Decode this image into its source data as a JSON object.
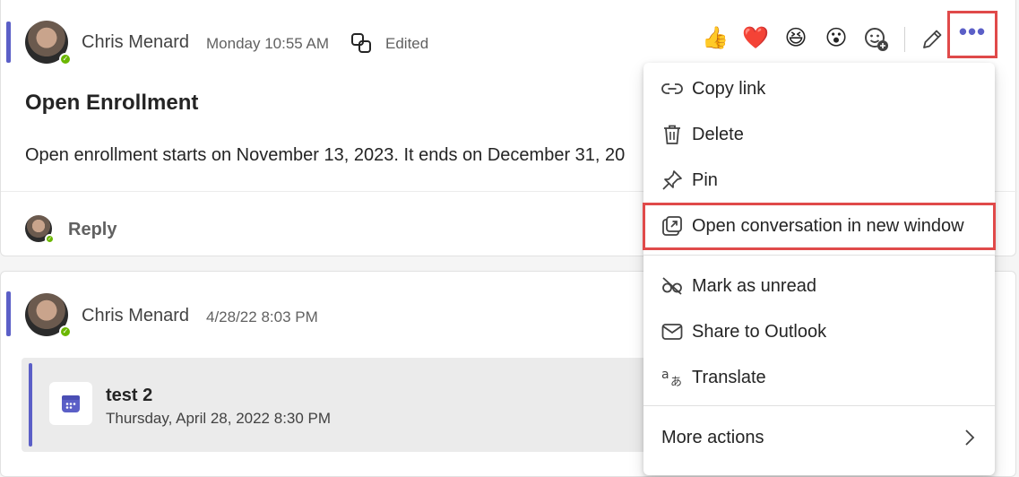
{
  "message1": {
    "author": "Chris Menard",
    "timestamp": "Monday 10:55 AM",
    "edited_label": "Edited",
    "title": "Open Enrollment",
    "body": "Open enrollment starts on November 13, 2023. It ends on December 31, 20",
    "reply_label": "Reply",
    "reactions": [
      "👍",
      "❤️",
      "😆",
      "😮"
    ]
  },
  "message2": {
    "author": "Chris Menard",
    "timestamp": "4/28/22 8:03 PM",
    "event": {
      "title": "test 2",
      "datetime": "Thursday, April 28, 2022 8:30 PM"
    }
  },
  "menu": {
    "items": [
      {
        "label": "Copy link",
        "icon": "link-icon"
      },
      {
        "label": "Delete",
        "icon": "trash-icon"
      },
      {
        "label": "Pin",
        "icon": "pin-icon"
      },
      {
        "label": "Open conversation in new window",
        "icon": "open-window-icon"
      },
      {
        "label": "Mark as unread",
        "icon": "eye-off-icon"
      },
      {
        "label": "Share to Outlook",
        "icon": "mail-icon"
      },
      {
        "label": "Translate",
        "icon": "translate-icon"
      },
      {
        "label": "More actions",
        "icon": "chevron-right-icon"
      }
    ]
  },
  "colors": {
    "accent": "#5b5fc7",
    "highlight": "#e04a4a",
    "presence": "#6bb700"
  }
}
